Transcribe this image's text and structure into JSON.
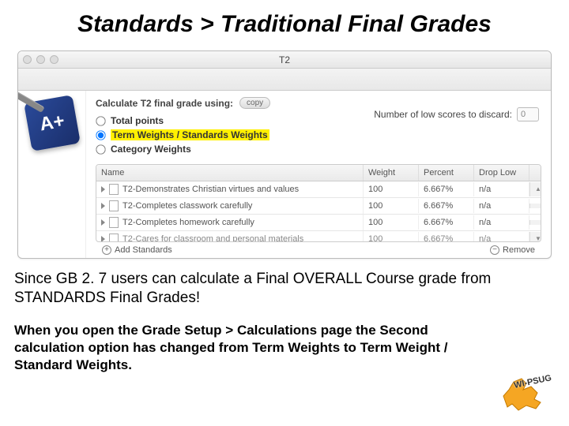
{
  "title": "Standards > Traditional Final Grades",
  "window": {
    "title": "T2",
    "icon_text": "A+"
  },
  "calc": {
    "label": "Calculate T2 final grade using:",
    "copy": "copy",
    "opt_total": "Total points",
    "opt_term": "Term Weights / Standards Weights",
    "opt_category": "Category Weights",
    "discard_label": "Number of low scores to discard:",
    "discard_value": "0"
  },
  "grid": {
    "headers": {
      "name": "Name",
      "weight": "Weight",
      "percent": "Percent",
      "droplow": "Drop Low"
    },
    "rows": [
      {
        "name": "T2-Demonstrates Christian virtues and values",
        "weight": "100",
        "percent": "6.667%",
        "droplow": "n/a"
      },
      {
        "name": "T2-Completes classwork carefully",
        "weight": "100",
        "percent": "6.667%",
        "droplow": "n/a"
      },
      {
        "name": "T2-Completes homework carefully",
        "weight": "100",
        "percent": "6.667%",
        "droplow": "n/a"
      },
      {
        "name": "T2-Cares for classroom and personal materials",
        "weight": "100",
        "percent": "6.667%",
        "droplow": "n/a"
      }
    ],
    "add": "Add Standards",
    "remove": "Remove"
  },
  "body1": "Since GB 2. 7 users can  calculate a Final OVERALL Course grade from STANDARDS Final Grades!",
  "body2": "When you open the Grade Setup > Calculations page the Second calculation option has changed from Term Weights to Term Weight / Standard Weights.",
  "logo": "WI-PSUG"
}
